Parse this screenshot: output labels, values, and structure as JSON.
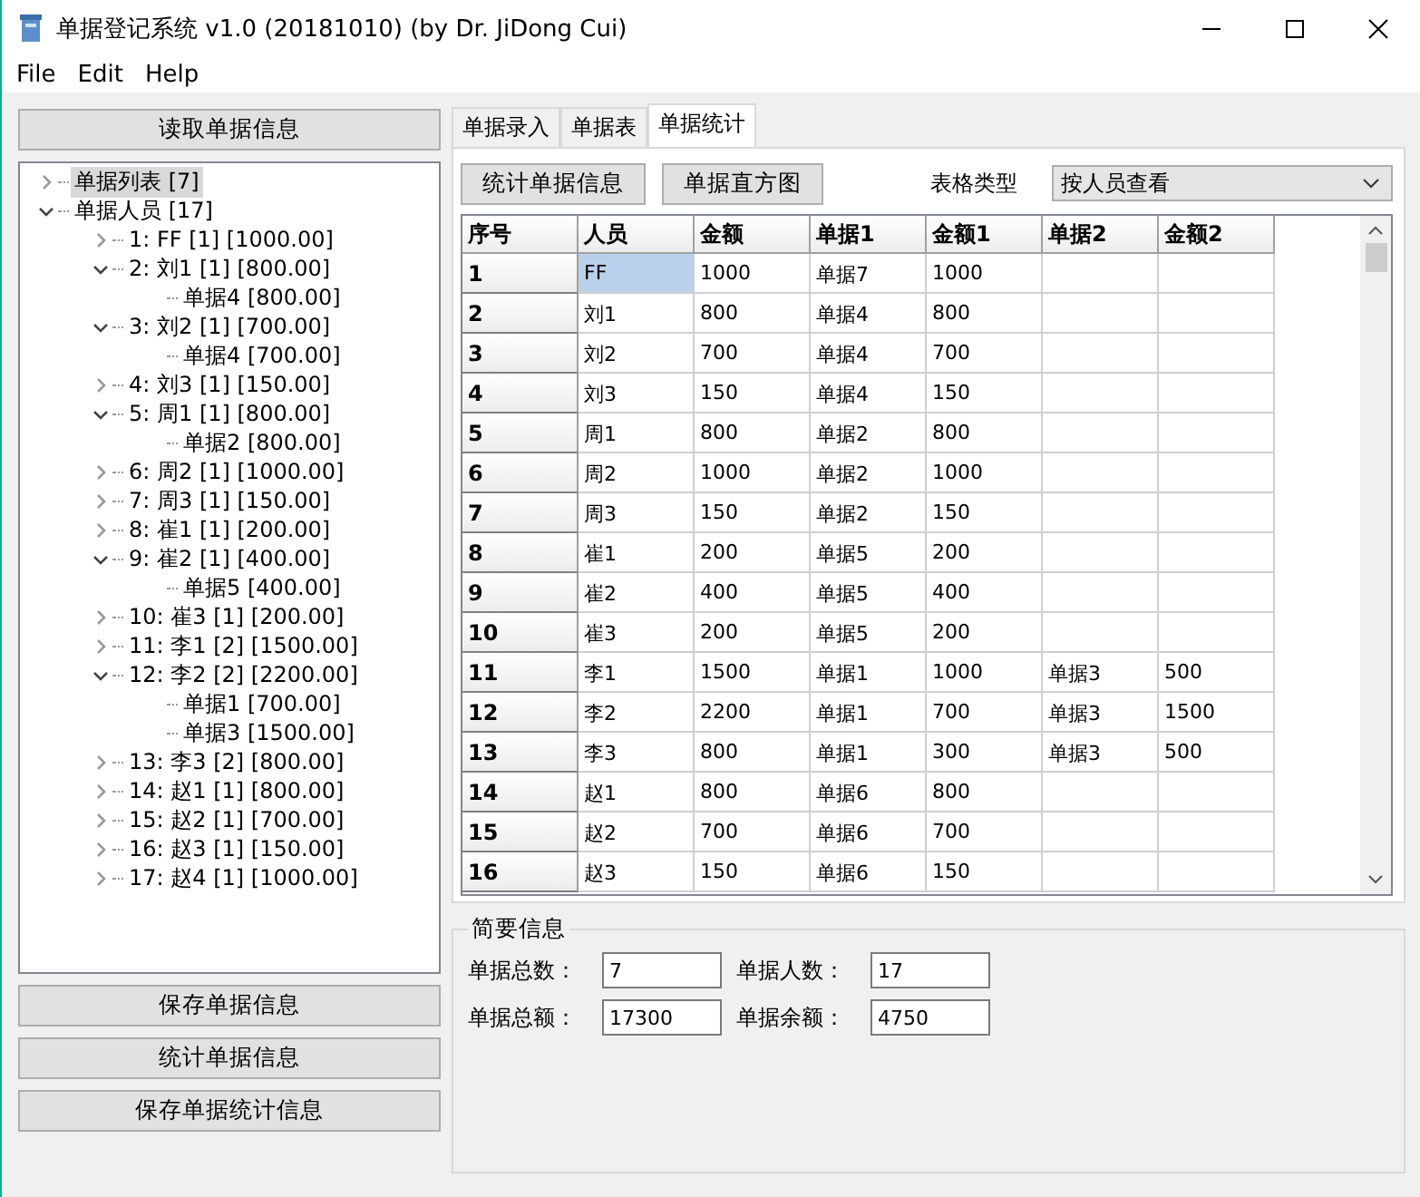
{
  "window": {
    "title": "单据登记系统 v1.0 (20181010) (by Dr. JiDong Cui)"
  },
  "menu": [
    "File",
    "Edit",
    "Help"
  ],
  "left_panel": {
    "top_button": "读取单据信息",
    "tree": [
      {
        "label": "单据列表 [7]",
        "expanded": false,
        "selected": true
      },
      {
        "label": "单据人员 [17]",
        "expanded": true,
        "selected": false,
        "children": [
          {
            "label": "1: FF [1] [1000.00]",
            "expanded": false,
            "selected": false
          },
          {
            "label": "2: 刘1 [1] [800.00]",
            "expanded": true,
            "selected": false,
            "children": [
              {
                "label": "单据4 [800.00]",
                "selected": false
              }
            ]
          },
          {
            "label": "3: 刘2 [1] [700.00]",
            "expanded": true,
            "selected": false,
            "children": [
              {
                "label": "单据4 [700.00]",
                "selected": false
              }
            ]
          },
          {
            "label": "4: 刘3 [1] [150.00]",
            "expanded": false,
            "selected": false
          },
          {
            "label": "5: 周1 [1] [800.00]",
            "expanded": true,
            "selected": false,
            "children": [
              {
                "label": "单据2 [800.00]",
                "selected": false
              }
            ]
          },
          {
            "label": "6: 周2 [1] [1000.00]",
            "expanded": false,
            "selected": false
          },
          {
            "label": "7: 周3 [1] [150.00]",
            "expanded": false,
            "selected": false
          },
          {
            "label": "8: 崔1 [1] [200.00]",
            "expanded": false,
            "selected": false
          },
          {
            "label": "9: 崔2 [1] [400.00]",
            "expanded": true,
            "selected": false,
            "children": [
              {
                "label": "单据5 [400.00]",
                "selected": false
              }
            ]
          },
          {
            "label": "10: 崔3 [1] [200.00]",
            "expanded": false,
            "selected": false
          },
          {
            "label": "11: 李1 [2] [1500.00]",
            "expanded": false,
            "selected": false
          },
          {
            "label": "12: 李2 [2] [2200.00]",
            "expanded": true,
            "selected": false,
            "children": [
              {
                "label": "单据1 [700.00]",
                "selected": false
              },
              {
                "label": "单据3 [1500.00]",
                "selected": false
              }
            ]
          },
          {
            "label": "13: 李3 [2] [800.00]",
            "expanded": false,
            "selected": false
          },
          {
            "label": "14: 赵1 [1] [800.00]",
            "expanded": false,
            "selected": false
          },
          {
            "label": "15: 赵2 [1] [700.00]",
            "expanded": false,
            "selected": false
          },
          {
            "label": "16: 赵3 [1] [150.00]",
            "expanded": false,
            "selected": false
          },
          {
            "label": "17: 赵4 [1] [1000.00]",
            "expanded": false,
            "selected": false
          }
        ]
      }
    ],
    "bottom_buttons": [
      "保存单据信息",
      "统计单据信息",
      "保存单据统计信息"
    ]
  },
  "tabs": [
    {
      "label": "单据录入",
      "selected": false
    },
    {
      "label": "单据表",
      "selected": false
    },
    {
      "label": "单据统计",
      "selected": true
    }
  ],
  "toolbar": {
    "buttons": [
      "统计单据信息",
      "单据直方图"
    ],
    "dropdown_label": "表格类型",
    "dropdown_value": "按人员查看"
  },
  "table": {
    "columns": [
      "序号",
      "人员",
      "金额",
      "单据1",
      "金额1",
      "单据2",
      "金额2"
    ],
    "rows": [
      {
        "cells": [
          "1",
          "FF",
          "1000",
          "单据7",
          "1000",
          null,
          null
        ],
        "selected": true
      },
      {
        "cells": [
          "2",
          "刘1",
          "800",
          "单据4",
          "800",
          null,
          null
        ],
        "selected": false
      },
      {
        "cells": [
          "3",
          "刘2",
          "700",
          "单据4",
          "700",
          null,
          null
        ],
        "selected": false
      },
      {
        "cells": [
          "4",
          "刘3",
          "150",
          "单据4",
          "150",
          null,
          null
        ],
        "selected": false
      },
      {
        "cells": [
          "5",
          "周1",
          "800",
          "单据2",
          "800",
          null,
          null
        ],
        "selected": false
      },
      {
        "cells": [
          "6",
          "周2",
          "1000",
          "单据2",
          "1000",
          null,
          null
        ],
        "selected": false
      },
      {
        "cells": [
          "7",
          "周3",
          "150",
          "单据2",
          "150",
          null,
          null
        ],
        "selected": false
      },
      {
        "cells": [
          "8",
          "崔1",
          "200",
          "单据5",
          "200",
          null,
          null
        ],
        "selected": false
      },
      {
        "cells": [
          "9",
          "崔2",
          "400",
          "单据5",
          "400",
          null,
          null
        ],
        "selected": false
      },
      {
        "cells": [
          "10",
          "崔3",
          "200",
          "单据5",
          "200",
          null,
          null
        ],
        "selected": false
      },
      {
        "cells": [
          "11",
          "李1",
          "1500",
          "单据1",
          "1000",
          "单据3",
          "500"
        ],
        "selected": false
      },
      {
        "cells": [
          "12",
          "李2",
          "2200",
          "单据1",
          "700",
          "单据3",
          "1500"
        ],
        "selected": false
      },
      {
        "cells": [
          "13",
          "李3",
          "800",
          "单据1",
          "300",
          "单据3",
          "500"
        ],
        "selected": false
      },
      {
        "cells": [
          "14",
          "赵1",
          "800",
          "单据6",
          "800",
          null,
          null
        ],
        "selected": false
      },
      {
        "cells": [
          "15",
          "赵2",
          "700",
          "单据6",
          "700",
          null,
          null
        ],
        "selected": false
      },
      {
        "cells": [
          "16",
          "赵3",
          "150",
          "单据6",
          "150",
          null,
          null
        ],
        "selected": false
      }
    ]
  },
  "summary": {
    "title": "简要信息",
    "fields": [
      {
        "label": "单据总数：",
        "value": "7"
      },
      {
        "label": "单据人数：",
        "value": "17"
      },
      {
        "label": "单据总额：",
        "value": "17300"
      },
      {
        "label": "单据余额：",
        "value": "4750"
      }
    ]
  }
}
